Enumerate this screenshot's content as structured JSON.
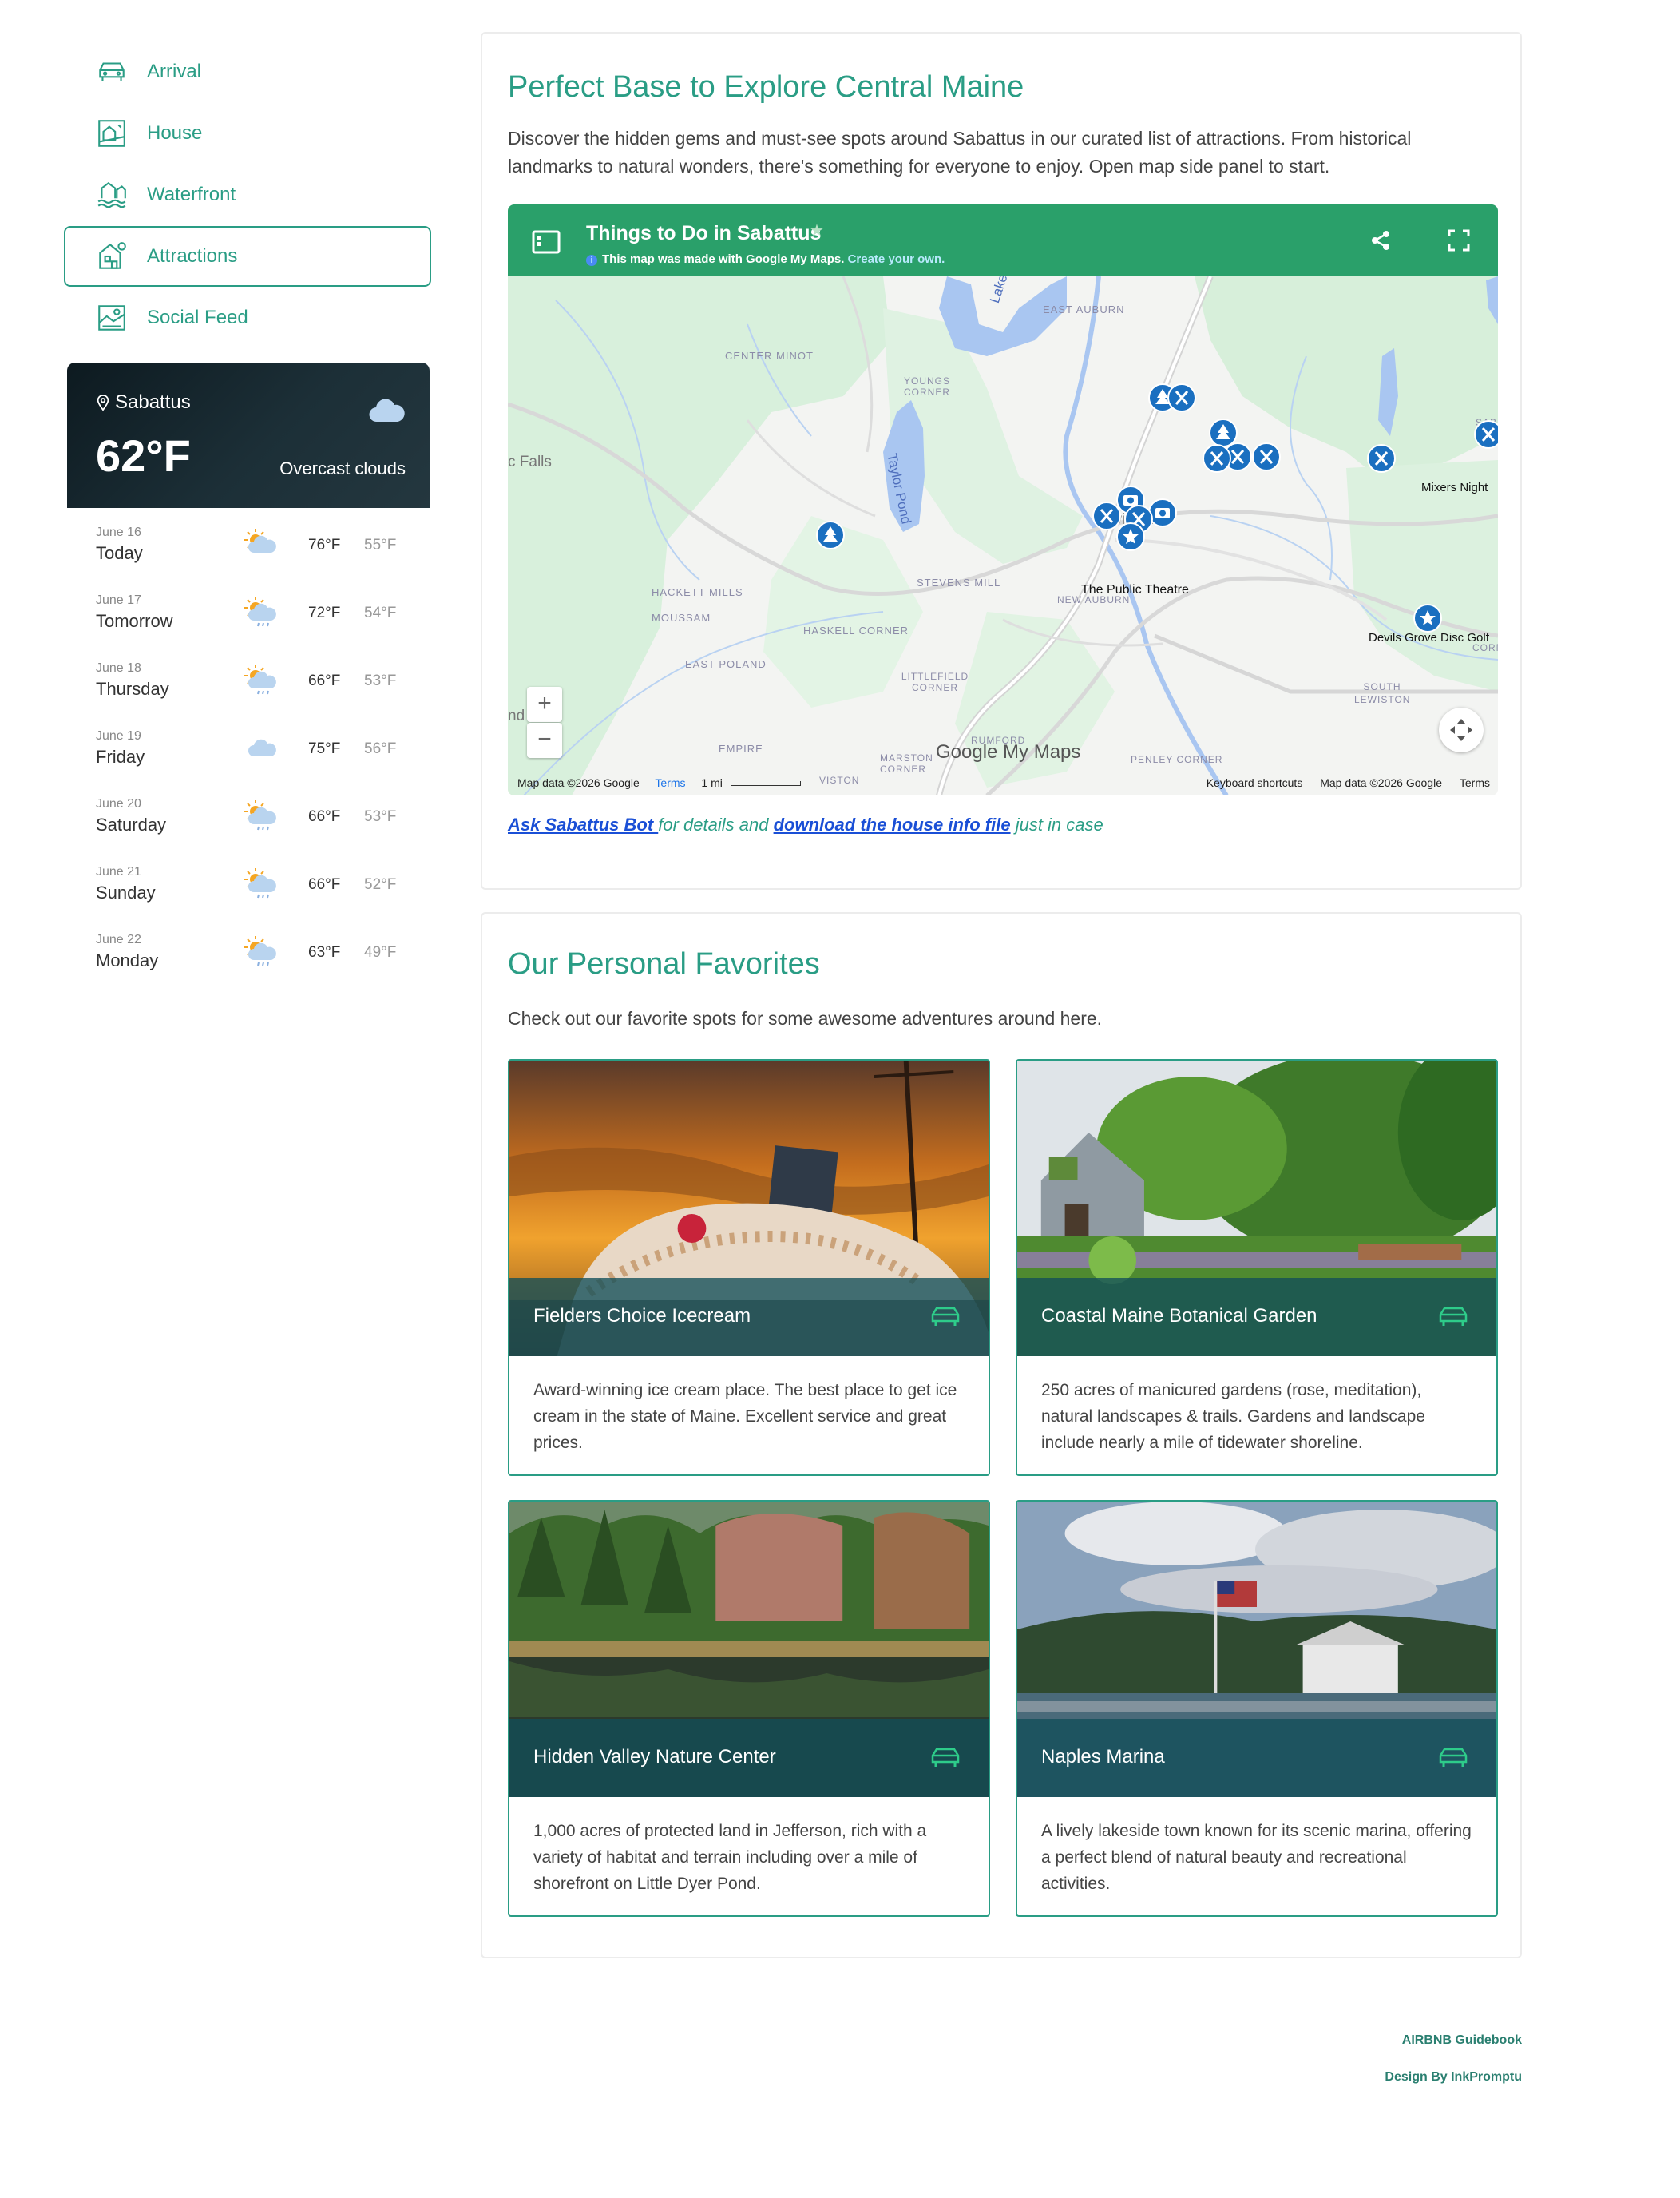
{
  "nav": {
    "items": [
      {
        "label": "Arrival",
        "icon": "car-icon"
      },
      {
        "label": "House",
        "icon": "house-map-icon"
      },
      {
        "label": "Waterfront",
        "icon": "waterfront-icon"
      },
      {
        "label": "Attractions",
        "icon": "attractions-icon",
        "active": true
      },
      {
        "label": "Social Feed",
        "icon": "social-feed-icon"
      }
    ]
  },
  "weather": {
    "location": "Sabattus",
    "temperature": "62°F",
    "condition": "Overcast clouds",
    "forecast": [
      {
        "date": "June 16",
        "day": "Today",
        "high": "76°F",
        "low": "55°F",
        "icon": "partly-cloudy-icon"
      },
      {
        "date": "June 17",
        "day": "Tomorrow",
        "high": "72°F",
        "low": "54°F",
        "icon": "sun-rain-icon"
      },
      {
        "date": "June 18",
        "day": "Thursday",
        "high": "66°F",
        "low": "53°F",
        "icon": "sun-rain-icon"
      },
      {
        "date": "June 19",
        "day": "Friday",
        "high": "75°F",
        "low": "56°F",
        "icon": "cloud-icon"
      },
      {
        "date": "June 20",
        "day": "Saturday",
        "high": "66°F",
        "low": "53°F",
        "icon": "sun-rain-icon"
      },
      {
        "date": "June 21",
        "day": "Sunday",
        "high": "66°F",
        "low": "52°F",
        "icon": "sun-rain-icon"
      },
      {
        "date": "June 22",
        "day": "Monday",
        "high": "63°F",
        "low": "49°F",
        "icon": "sun-rain-icon"
      }
    ]
  },
  "explore": {
    "title": "Perfect Base to Explore Central Maine",
    "description": "Discover the hidden gems and must-see spots around Sabattus in our curated list of attractions. From historical landmarks to natural wonders, there's something for everyone to enjoy. Open map side panel to start.",
    "map": {
      "title": "Things to Do in Sabattus",
      "subtitle": "This map was made with Google My Maps.",
      "subtitle_link": "Create your own.",
      "places": [
        "EAST AUBURN",
        "CENTER MINOT",
        "YOUNGS CORNER",
        "Lake Auburn",
        "Taylor Pond",
        "Lewiston",
        "The Public Theatre",
        "NEW AUBURN",
        "STEVENS MILL",
        "HACKETT MILLS",
        "MOUSSAM",
        "HASKELL CORNER",
        "EAST POLAND",
        "LITTLEFIELD CORNER",
        "EMPIRE",
        "RUMFORD",
        "MARSTON CORNER",
        "PENLEY CORNER",
        "SOUTH LEWISTON",
        "Mixers Night",
        "Devils Grove Disc Golf",
        "c Falls",
        "nd",
        "VISTON",
        "SAB",
        "CORN"
      ],
      "footer_left": [
        "Map data ©2026 Google",
        "Terms",
        "1 mi"
      ],
      "footer_right": [
        "Keyboard shortcuts",
        "Map data ©2026 Google",
        "Terms"
      ],
      "logo": "Google My Maps"
    },
    "links": {
      "bot": "Ask Sabattus Bot ",
      "mid": "for details and ",
      "download": "download the house info file",
      "end": " just in case"
    }
  },
  "favorites": {
    "title": "Our Personal Favorites",
    "description": "Check out our favorite spots for some awesome adventures around here.",
    "items": [
      {
        "name": "Fielders Choice Icecream",
        "text": "Award-winning ice cream place. The best place to get ice cream in the state of Maine. Excellent service and great prices."
      },
      {
        "name": "Coastal Maine Botanical Garden",
        "text": "250 acres of manicured gardens (rose, meditation), natural landscapes & trails. Gardens and landscape include nearly a mile of tidewater shoreline."
      },
      {
        "name": "Hidden Valley Nature Center",
        "text": "1,000 acres of protected land in Jefferson, rich with a variety of habitat and terrain including over a mile of shorefront on Little Dyer Pond."
      },
      {
        "name": "Naples Marina",
        "text": "A lively lakeside town known for its scenic marina, offering a perfect blend of natural beauty and recreational activities."
      }
    ]
  },
  "footer": {
    "line1": "AIRBNB Guidebook",
    "line2": "Design By InkPromptu"
  },
  "colors": {
    "accent": "#2a9d85",
    "map_header": "#2aa06a",
    "pin": "#1a6fc0"
  }
}
